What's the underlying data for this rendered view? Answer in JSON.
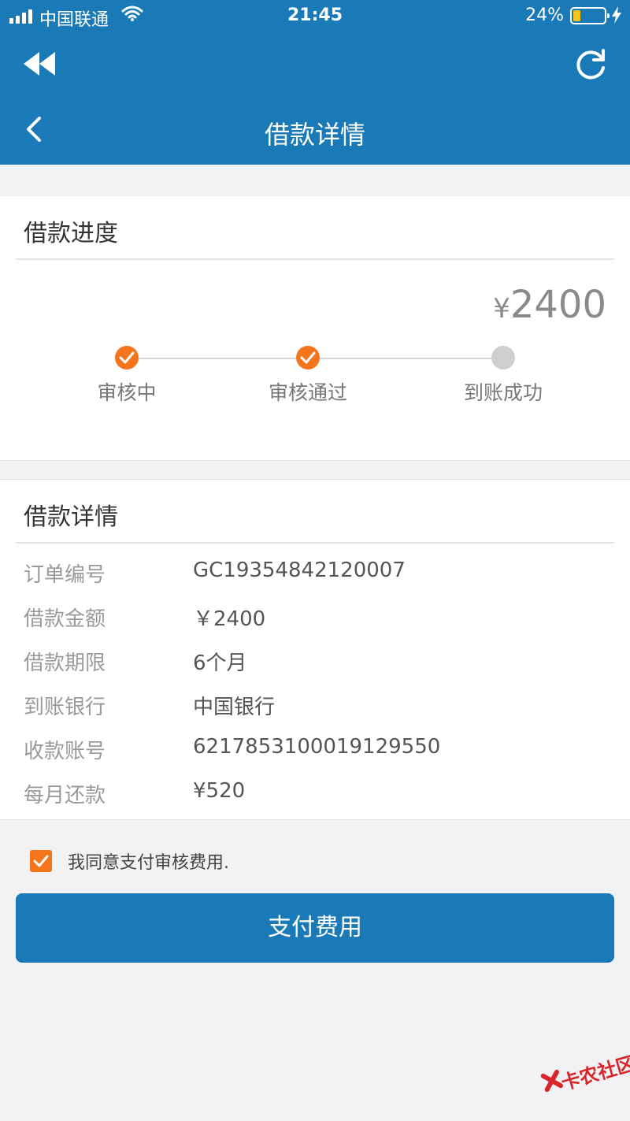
{
  "status_bar": {
    "carrier": "中国联通",
    "time": "21:45",
    "battery_percent": "24%",
    "battery_level": 0.24
  },
  "nav": {
    "title": "借款详情",
    "icons": [
      "rewind-icon",
      "refresh-icon",
      "back-icon"
    ]
  },
  "progress_section": {
    "title": "借款进度",
    "currency_symbol": "¥",
    "amount": "2400",
    "steps": [
      {
        "label": "审核中",
        "status": "done"
      },
      {
        "label": "审核通过",
        "status": "done"
      },
      {
        "label": "到账成功",
        "status": "pending"
      }
    ]
  },
  "details_section": {
    "title": "借款详情",
    "rows": [
      {
        "label": "订单编号",
        "value": "GC19354842120007"
      },
      {
        "label": "借款金额",
        "value": "￥2400"
      },
      {
        "label": "借款期限",
        "value": "6个月"
      },
      {
        "label": "到账银行",
        "value": "中国银行"
      },
      {
        "label": "收款账号",
        "value": "6217853100019129550"
      },
      {
        "label": "每月还款",
        "value": "¥520"
      }
    ]
  },
  "agreement": {
    "checked": true,
    "text": "我同意支付审核费用."
  },
  "pay_button": {
    "label": "支付费用"
  },
  "watermark": {
    "text": "卡农社区"
  },
  "colors": {
    "primary": "#1a7ab7",
    "accent": "#f5751c",
    "pending": "#cfcfcf",
    "battery": "#f5c518",
    "watermark": "#d8262d"
  }
}
